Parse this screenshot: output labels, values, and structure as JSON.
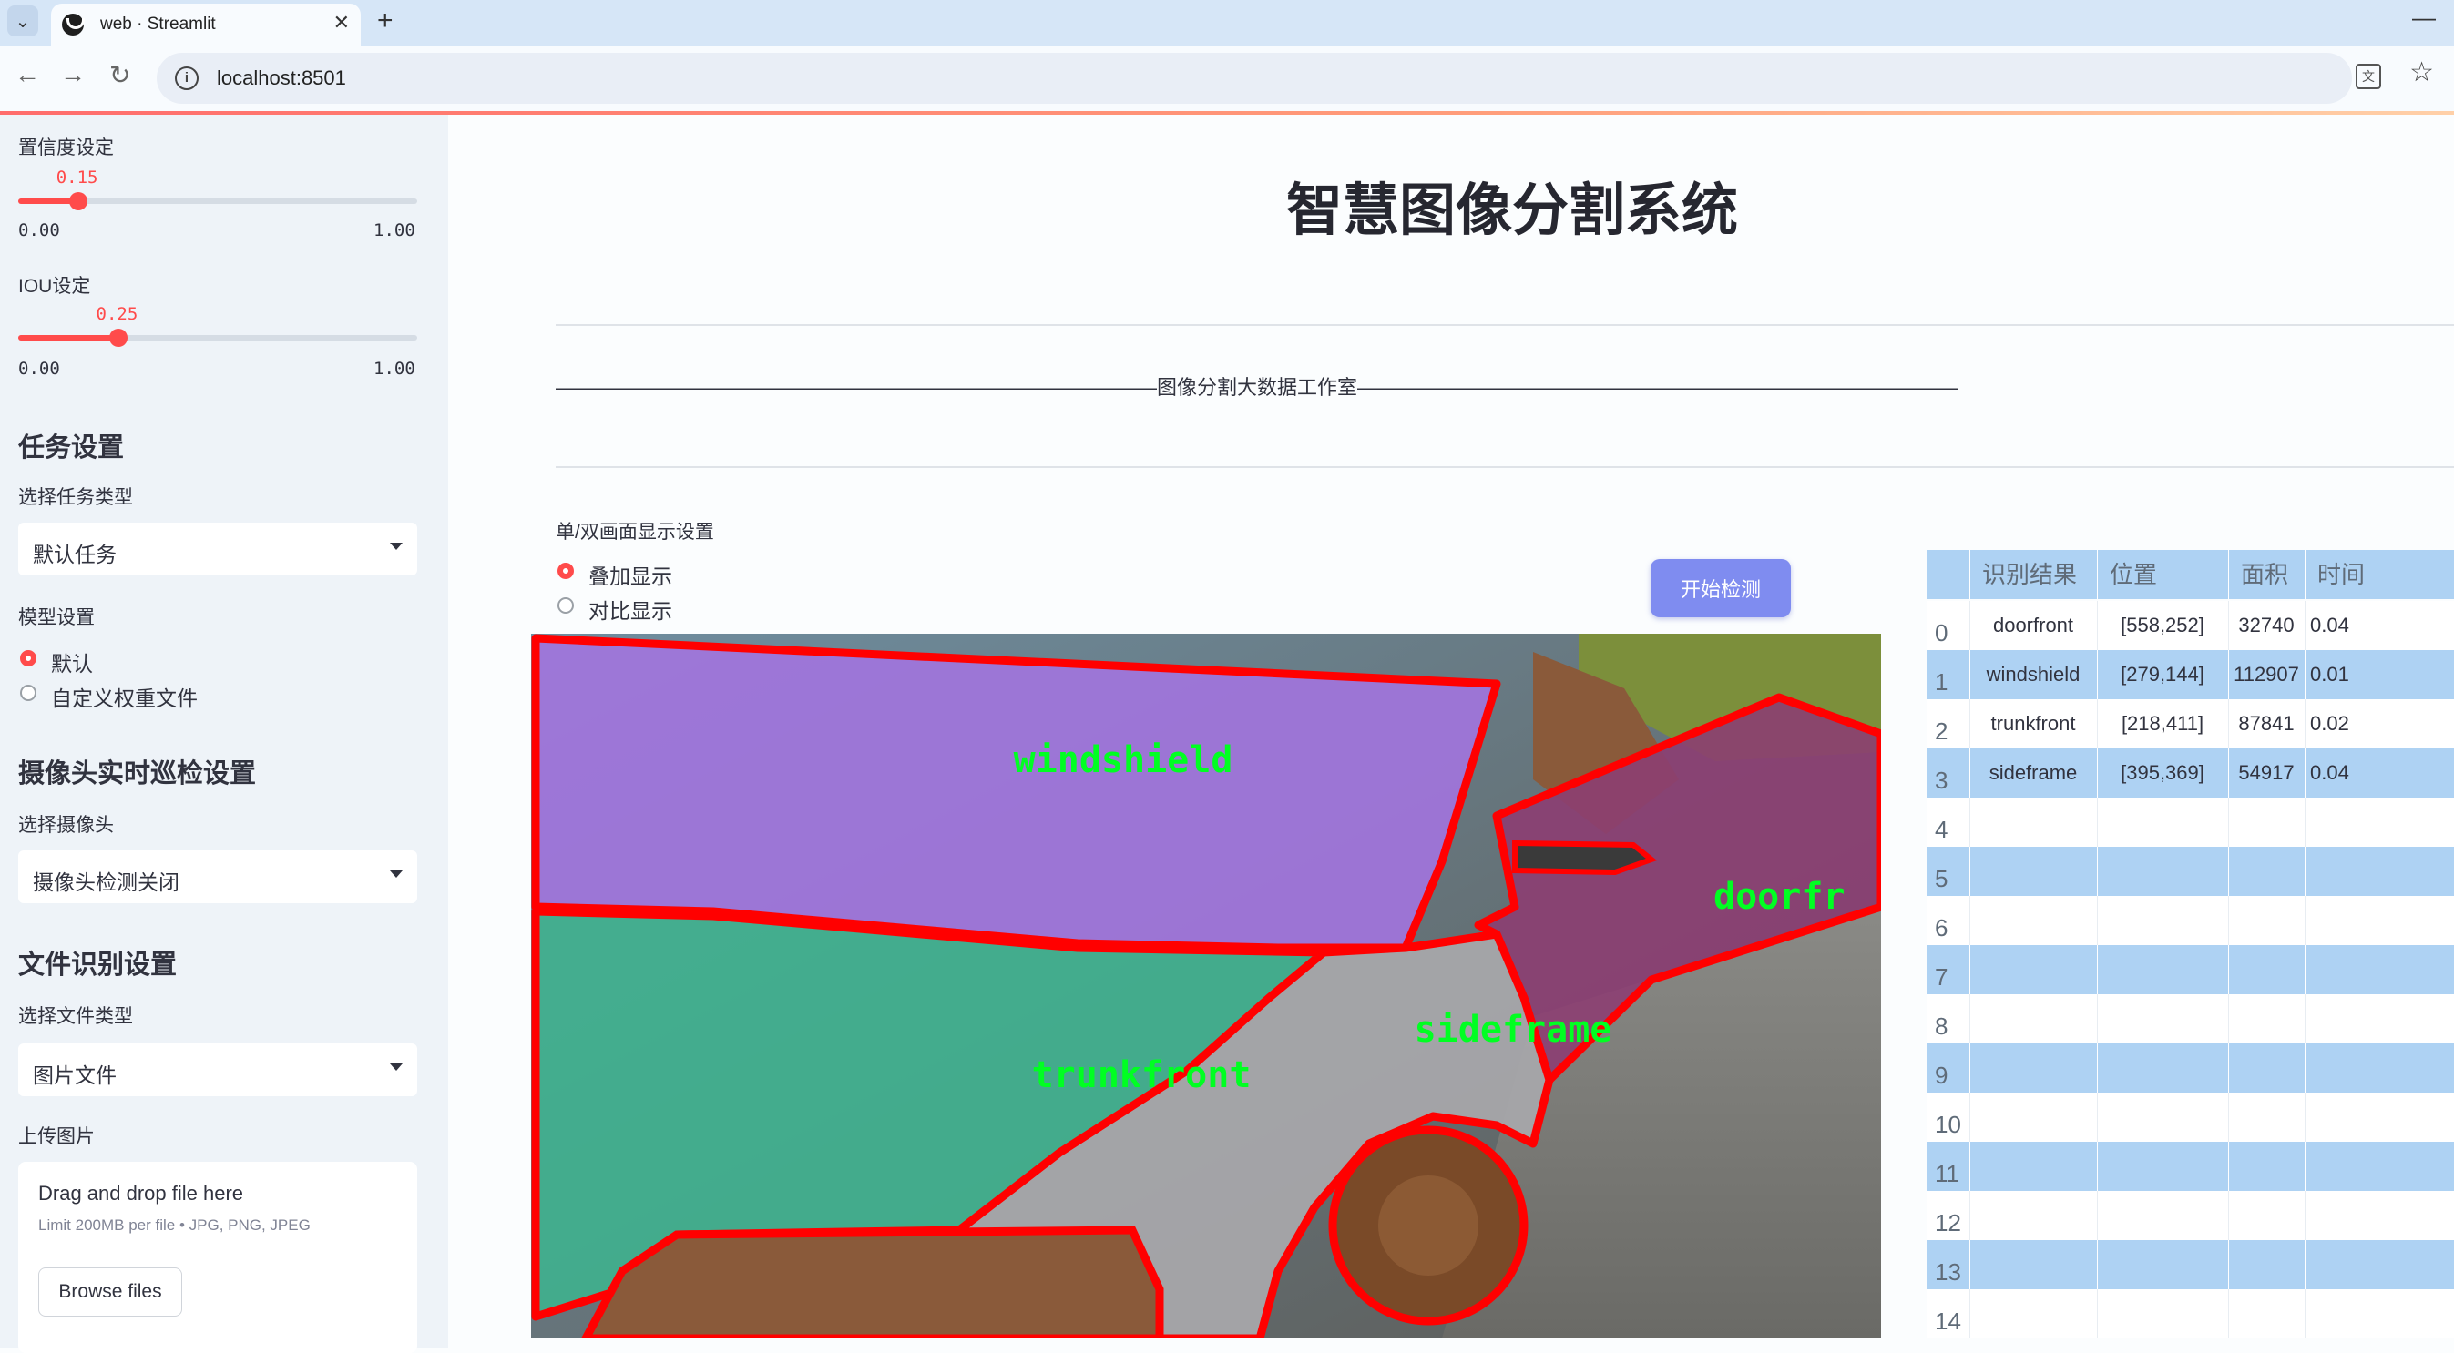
{
  "browser": {
    "tab_title": "web · Streamlit",
    "url": "localhost:8501",
    "new_tab_glyph": "+",
    "close_glyph": "✕",
    "minimize_glyph": "—"
  },
  "sidebar": {
    "confidence": {
      "label": "置信度设定",
      "value": 0.15,
      "value_text": "0.15",
      "min_text": "0.00",
      "max_text": "1.00"
    },
    "iou": {
      "label": "IOU设定",
      "value": 0.25,
      "value_text": "0.25",
      "min_text": "0.00",
      "max_text": "1.00"
    },
    "task_section": {
      "heading": "任务设置",
      "select_label": "选择任务类型",
      "select_value": "默认任务"
    },
    "model_section": {
      "label": "模型设置",
      "options": [
        "默认",
        "自定义权重文件"
      ],
      "selected": 0
    },
    "camera_section": {
      "heading": "摄像头实时巡检设置",
      "select_label": "选择摄像头",
      "select_value": "摄像头检测关闭"
    },
    "file_section": {
      "heading": "文件识别设置",
      "select_label": "选择文件类型",
      "select_value": "图片文件",
      "upload_label": "上传图片"
    },
    "uploader": {
      "title": "Drag and drop file here",
      "limit": "Limit 200MB per file • JPG, PNG, JPEG",
      "button": "Browse files"
    }
  },
  "main": {
    "title": "智慧图像分割系统",
    "subtitle_line": "——————————————————————————————图像分割大数据工作室——————————————————————————————",
    "display_setting_label": "单/双画面显示设置",
    "display_options": [
      "叠加显示",
      "对比显示"
    ],
    "display_selected": 0,
    "detect_button": "开始检测"
  },
  "image_labels": {
    "windshield": "windshield",
    "doorfront": "doorfr",
    "sideframe": "sideframe",
    "trunkfront": "trunkfront"
  },
  "colors": {
    "accent": "#ff4b4b",
    "button": "#7f8cf0",
    "table_stripe": "#aed2f3",
    "mask_outline": "#ff0000",
    "mask_label": "#00ff22"
  },
  "table": {
    "headers": [
      "识别结果",
      "位置",
      "面积",
      "时间"
    ],
    "rows": [
      {
        "index": "0",
        "label": "doorfront",
        "position": "[558,252]",
        "area": "32740",
        "time": "0.04"
      },
      {
        "index": "1",
        "label": "windshield",
        "position": "[279,144]",
        "area": "112907",
        "time": "0.01"
      },
      {
        "index": "2",
        "label": "trunkfront",
        "position": "[218,411]",
        "area": "87841",
        "time": "0.02"
      },
      {
        "index": "3",
        "label": "sideframe",
        "position": "[395,369]",
        "area": "54917",
        "time": "0.04"
      },
      {
        "index": "4"
      },
      {
        "index": "5"
      },
      {
        "index": "6"
      },
      {
        "index": "7"
      },
      {
        "index": "8"
      },
      {
        "index": "9"
      },
      {
        "index": "10"
      },
      {
        "index": "11"
      },
      {
        "index": "12"
      },
      {
        "index": "13"
      },
      {
        "index": "14"
      }
    ]
  }
}
